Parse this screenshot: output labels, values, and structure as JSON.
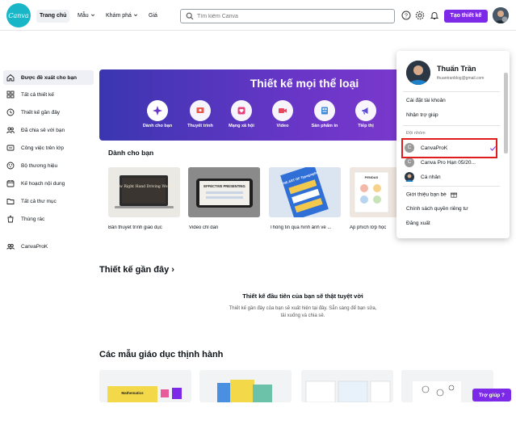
{
  "brand": {
    "logo_text": "Canva",
    "accent": "#7d2ae8",
    "logo_color": "#19b6c7"
  },
  "nav": {
    "home": "Trang chủ",
    "templates": "Mẫu",
    "discover": "Khám phá",
    "pricing": "Giá"
  },
  "search": {
    "placeholder": "Tìm kiếm Canva"
  },
  "topbar": {
    "create_label": "Tạo thiết kế",
    "icons": [
      "help-icon",
      "settings-icon",
      "bell-icon"
    ]
  },
  "sidebar": {
    "items": [
      {
        "label": "Được đề xuất cho bạn",
        "icon": "home-icon"
      },
      {
        "label": "Tất cả thiết kế",
        "icon": "grid-icon"
      },
      {
        "label": "Thiết kế gần đây",
        "icon": "clock-icon"
      },
      {
        "label": "Đã chia sẻ với bạn",
        "icon": "people-icon"
      },
      {
        "label": "Công việc trên lớp",
        "icon": "class-icon"
      },
      {
        "label": "Bộ thương hiệu",
        "icon": "brand-icon"
      },
      {
        "label": "Kế hoạch nội dung",
        "icon": "calendar-icon"
      },
      {
        "label": "Tất cả thư mục",
        "icon": "folder-icon"
      },
      {
        "label": "Thùng rác",
        "icon": "trash-icon"
      },
      {
        "label": "CanvaProK",
        "icon": "team-icon"
      }
    ]
  },
  "hero": {
    "title": "Thiết kế mọi thể loại",
    "categories": [
      {
        "label": "Dành cho bạn",
        "icon": "sparkle-icon"
      },
      {
        "label": "Thuyết trình",
        "icon": "presentation-icon"
      },
      {
        "label": "Mạng xã hội",
        "icon": "heart-icon"
      },
      {
        "label": "Video",
        "icon": "video-icon"
      },
      {
        "label": "Sản phẩm in",
        "icon": "print-icon"
      },
      {
        "label": "Tiếp thị",
        "icon": "megaphone-icon"
      }
    ]
  },
  "for_you": {
    "title": "Dành cho bạn",
    "cards": [
      {
        "caption": "Bản thuyết trình giáo dục",
        "thumb_text": "How Right Hand Driving Works"
      },
      {
        "caption": "Video chỉ dẫn",
        "thumb_text": "EFFECTIVE PRESENTING"
      },
      {
        "caption": "Thông tin qua hình ảnh về ...",
        "thumb_text": "THE ART OF Typography"
      },
      {
        "caption": "Áp phích lớp học",
        "thumb_text": "PENDAS"
      }
    ]
  },
  "recent": {
    "title": "Thiết kế gần đây ›",
    "empty_title": "Thiết kế đầu tiên của bạn sẽ thật tuyệt vời",
    "empty_desc": "Thiết kế gần đây của bạn sẽ xuất hiện tại đây. Sẵn sàng để bạn sửa, tải xuống và chia sẻ."
  },
  "trending": {
    "title": "Các mẫu giáo dục thịnh hành",
    "first_thumb_text": "Mathematics"
  },
  "help": {
    "label": "Trợ giúp ?"
  },
  "account_menu": {
    "name": "Thuấn Trần",
    "email": "thuantranblog@gmail.com",
    "items_top": [
      "Cài đặt tài khoản",
      "Nhận trợ giúp"
    ],
    "teams_header": "Đội nhóm",
    "teams": [
      {
        "name": "CanvaProK",
        "initial": "C",
        "selected": true
      },
      {
        "name": "Canva Pro Hạn 05/20...",
        "initial": "C",
        "selected": false
      },
      {
        "name": "Cá nhân",
        "initial": "",
        "selected": false
      }
    ],
    "items_bottom": [
      "Giới thiệu bạn bè",
      "Chính sách quyền riêng tư",
      "Đăng xuất"
    ]
  }
}
